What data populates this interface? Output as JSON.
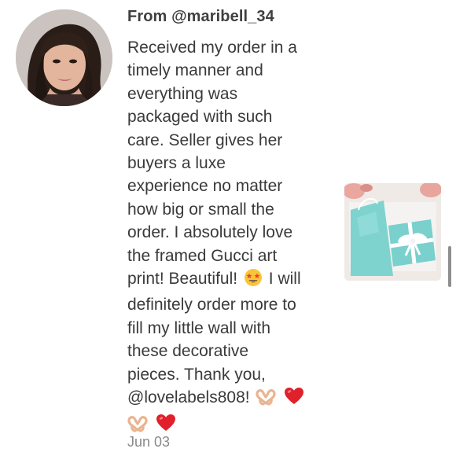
{
  "review": {
    "author_prefix": "From ",
    "author_handle": "@maribell_34",
    "lines": {
      "l1": "Received my order in a",
      "l2": "timely manner and",
      "l3": "everything was",
      "l4": "packaged with such",
      "l5": "care. Seller gives her",
      "l6": "buyers a luxe",
      "l7": "experience no matter",
      "l8": "how big or small the",
      "l9": "order. I absolutely love",
      "l10": "the framed Gucci art",
      "l11a": "print! Beautiful!",
      "l11b": "I will",
      "l12": "definitely order more to",
      "l13": "fill my little wall with",
      "l14": "these decorative",
      "l15": "pieces. Thank you,",
      "l16": "@lovelabels808!"
    },
    "date": "Jun 03"
  },
  "icons": {
    "avatar": "reviewer-avatar-photo",
    "star_struck": "star-struck-emoji",
    "heart_hands": "heart-hands-emoji",
    "red_heart": "red-heart-emoji",
    "attachment": "tiffany-blue-gift-box-photo"
  },
  "colors": {
    "text": "#3a3a3a",
    "date": "#8a8a8a",
    "heart": "#e0202a",
    "tiffany_blue": "#7fd3cf"
  }
}
